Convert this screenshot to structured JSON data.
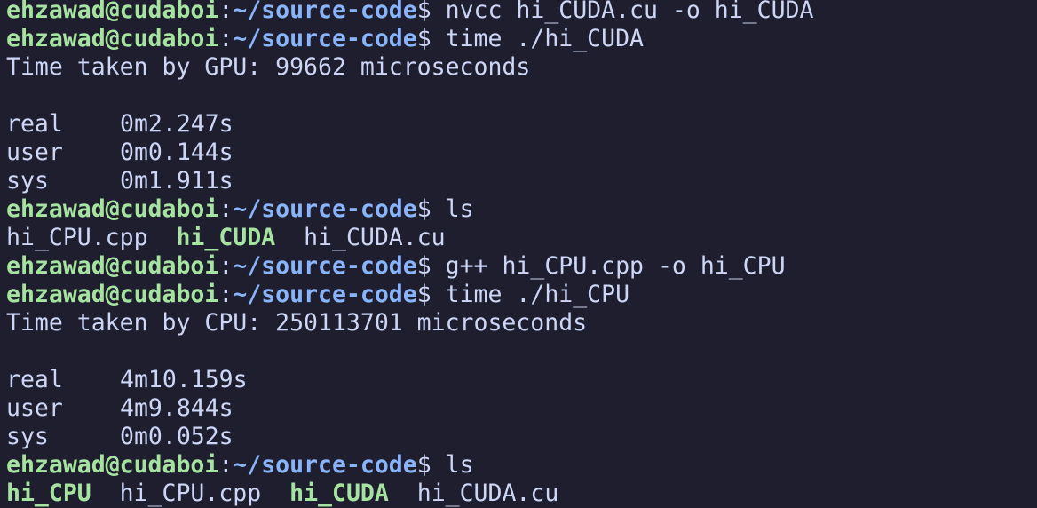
{
  "prompt": {
    "user_host": "ehzawad@cudaboi",
    "colon": ":",
    "path": "~/source-code",
    "dollar": "$"
  },
  "lines": [
    {
      "type": "prompt",
      "command": " nvcc hi_CUDA.cu -o hi_CUDA"
    },
    {
      "type": "prompt",
      "command": " time ./hi_CUDA"
    },
    {
      "type": "output",
      "text": "Time taken by GPU: 99662 microseconds"
    },
    {
      "type": "blank"
    },
    {
      "type": "timing",
      "label": "real",
      "value": "0m2.247s"
    },
    {
      "type": "timing",
      "label": "user",
      "value": "0m0.144s"
    },
    {
      "type": "timing",
      "label": "sys",
      "value": "0m1.911s"
    },
    {
      "type": "prompt",
      "command": " ls"
    },
    {
      "type": "listing",
      "entries": [
        {
          "name": "hi_CPU.cpp",
          "exec": false
        },
        {
          "name": "hi_CUDA",
          "exec": true
        },
        {
          "name": "hi_CUDA.cu",
          "exec": false
        }
      ]
    },
    {
      "type": "prompt",
      "command": " g++ hi_CPU.cpp -o hi_CPU"
    },
    {
      "type": "prompt",
      "command": " time ./hi_CPU"
    },
    {
      "type": "output",
      "text": "Time taken by CPU: 250113701 microseconds"
    },
    {
      "type": "blank"
    },
    {
      "type": "timing",
      "label": "real",
      "value": "4m10.159s"
    },
    {
      "type": "timing",
      "label": "user",
      "value": "4m9.844s"
    },
    {
      "type": "timing",
      "label": "sys",
      "value": "0m0.052s"
    },
    {
      "type": "prompt",
      "command": " ls"
    },
    {
      "type": "listing",
      "entries": [
        {
          "name": "hi_CPU",
          "exec": true
        },
        {
          "name": "hi_CPU.cpp",
          "exec": false
        },
        {
          "name": "hi_CUDA",
          "exec": true
        },
        {
          "name": "hi_CUDA.cu",
          "exec": false
        }
      ]
    }
  ],
  "colors": {
    "background": "#1e1e2e",
    "foreground": "#cdd6f4",
    "prompt_user": "#a6e3a1",
    "prompt_path": "#89b4fa",
    "executable": "#a6e3a1"
  }
}
